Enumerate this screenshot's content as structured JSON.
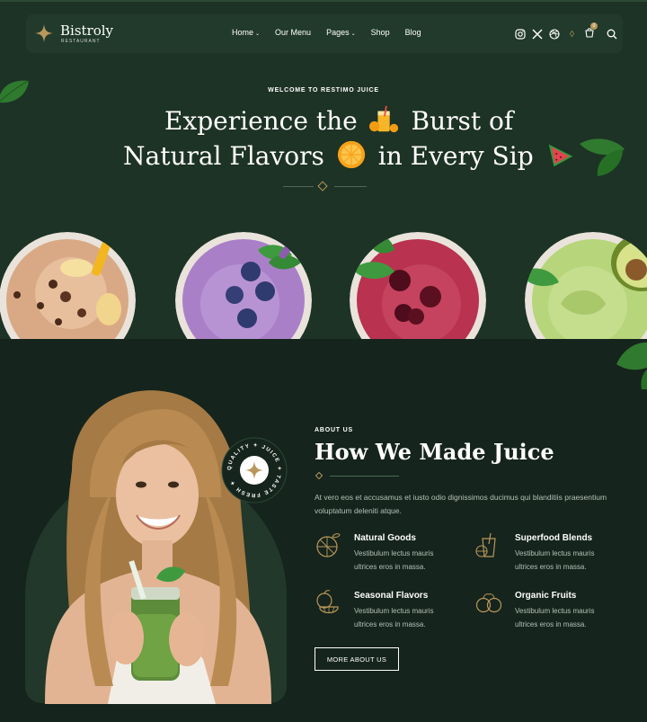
{
  "colors": {
    "hero_bg": "#1d3325",
    "about_bg": "#15241c",
    "nav_bg": "#213a2b",
    "accent_gold": "#b9975b",
    "leaf_green": "#2f7a2f"
  },
  "brand": {
    "name": "Bistroly",
    "tagline": "RESTAURANT",
    "icon": "four-point-star-icon"
  },
  "nav": {
    "items": [
      {
        "label": "Home",
        "has_dropdown": true
      },
      {
        "label": "Our Menu",
        "has_dropdown": false
      },
      {
        "label": "Pages",
        "has_dropdown": true
      },
      {
        "label": "Shop",
        "has_dropdown": false
      },
      {
        "label": "Blog",
        "has_dropdown": false
      }
    ],
    "caret": "⌄",
    "icons": [
      "instagram-icon",
      "x-twitter-icon",
      "dribbble-icon",
      "cart-icon",
      "search-icon"
    ],
    "cart_count": "0"
  },
  "hero": {
    "kicker": "WELCOME TO RESTIMO JUICE",
    "line1_a": "Experience the",
    "line1_b": "Burst of",
    "line2_a": "Natural Flavors",
    "line2_b": "in Every Sip"
  },
  "about": {
    "kicker": "ABOUT US",
    "title": "How We Made Juice",
    "text": "At vero eos et accusamus et iusto odio dignissimos ducimus qui blanditiis praesentium voluptatum deleniti atque.",
    "badge_text": "QUALITY ✦ JUICE ✦ TASTE FRESH ✦",
    "features": [
      {
        "title": "Natural Goods",
        "desc": "Vestibulum lectus mauris ultrices eros in massa.",
        "icon": "orange-slice-icon"
      },
      {
        "title": "Superfood Blends",
        "desc": "Vestibulum lectus mauris ultrices eros in massa.",
        "icon": "juice-glass-icon"
      },
      {
        "title": "Seasonal Flavors",
        "desc": "Vestibulum lectus mauris ultrices eros in massa.",
        "icon": "fruit-basket-icon"
      },
      {
        "title": "Organic Fruits",
        "desc": "Vestibulum lectus mauris ultrices eros in massa.",
        "icon": "apple-pair-icon"
      }
    ],
    "button_label": "MORE ABOUT US"
  }
}
